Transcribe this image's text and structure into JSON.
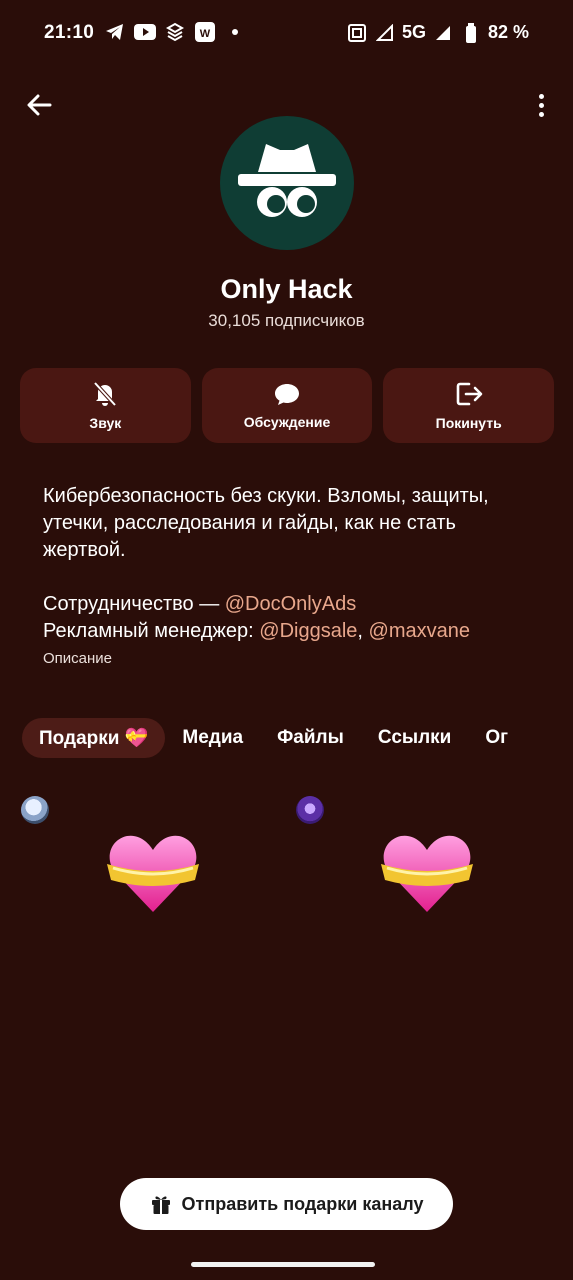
{
  "status_bar": {
    "time": "21:10",
    "network": "5G",
    "battery": "82 %"
  },
  "channel": {
    "title": "Only Hack",
    "subscribers": "30,105 подписчиков"
  },
  "actions": [
    {
      "label": "Звук",
      "icon": "bell-off-icon"
    },
    {
      "label": "Обсуждение",
      "icon": "chat-bubble-icon"
    },
    {
      "label": "Покинуть",
      "icon": "exit-icon"
    }
  ],
  "description": {
    "line1": "Кибербезопасность без скуки. Взломы, защиты, утечки, расследования и гайды, как не стать жертвой.",
    "coop_prefix": "Сотрудничество — ",
    "coop_link": "@DocOnlyAds",
    "manager_prefix": "Рекламный менеджер: ",
    "manager_link1": "@Diggsale",
    "manager_sep": ", ",
    "manager_link2": "@maxvane",
    "label": "Описание"
  },
  "tabs": [
    {
      "label": "Подарки 💝",
      "active": true
    },
    {
      "label": "Медиа",
      "active": false
    },
    {
      "label": "Файлы",
      "active": false
    },
    {
      "label": "Ссылки",
      "active": false
    },
    {
      "label": "Ог",
      "active": false
    }
  ],
  "send_gifts_button": "Отправить подарки каналу",
  "colors": {
    "background": "#2a0d09",
    "button_bg": "#4a1712",
    "link": "#e8a78c",
    "avatar_bg": "#0f3d34"
  }
}
